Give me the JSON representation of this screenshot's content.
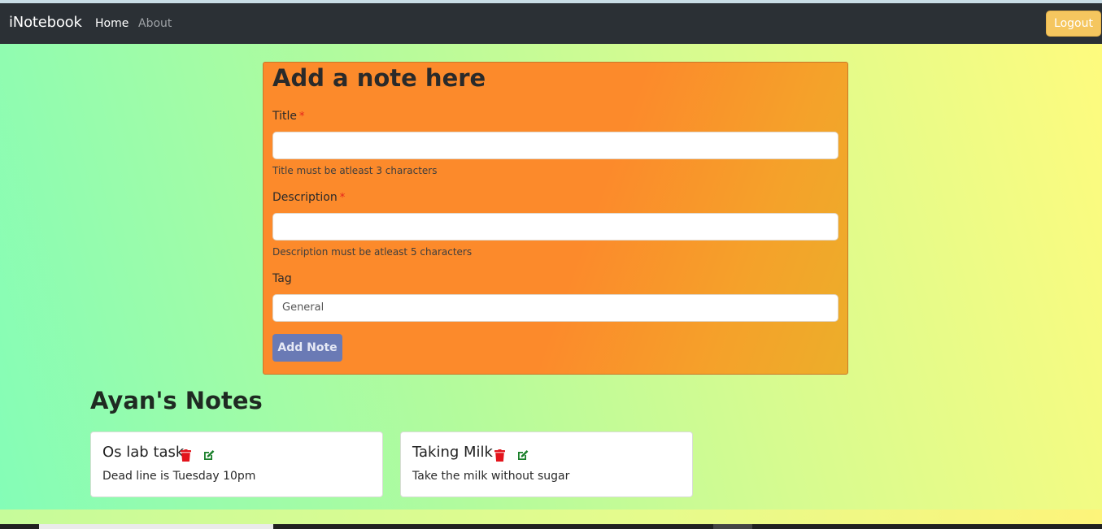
{
  "navbar": {
    "brand": "iNotebook",
    "links": [
      "Home",
      "About"
    ],
    "logout_label": "Logout"
  },
  "form": {
    "heading": "Add a note here",
    "title_label": "Title",
    "required_mark": "*",
    "title_value": "",
    "title_hint": "Title must be atleast 3 characters",
    "description_label": "Description",
    "description_value": "",
    "description_hint": "Description must be atleast 5 characters",
    "tag_label": "Tag",
    "tag_value": "General",
    "submit_label": "Add Note"
  },
  "notes": {
    "heading": "Ayan's Notes",
    "items": [
      {
        "title": "Os lab task",
        "description": "Dead line is Tuesday 10pm",
        "delete_icon": "trash-icon",
        "edit_icon": "edit-icon"
      },
      {
        "title": "Taking Milk",
        "description": "Take the milk without sugar",
        "delete_icon": "trash-icon",
        "edit_icon": "edit-icon"
      }
    ]
  },
  "colors": {
    "navbar_bg": "#2b3035",
    "form_card_bg": "#fc8a2b",
    "logout_bg": "#f5c65f",
    "add_button_bg": "#6a7ab5",
    "delete_icon": "#e3141c",
    "edit_icon": "#1a7f2a"
  }
}
